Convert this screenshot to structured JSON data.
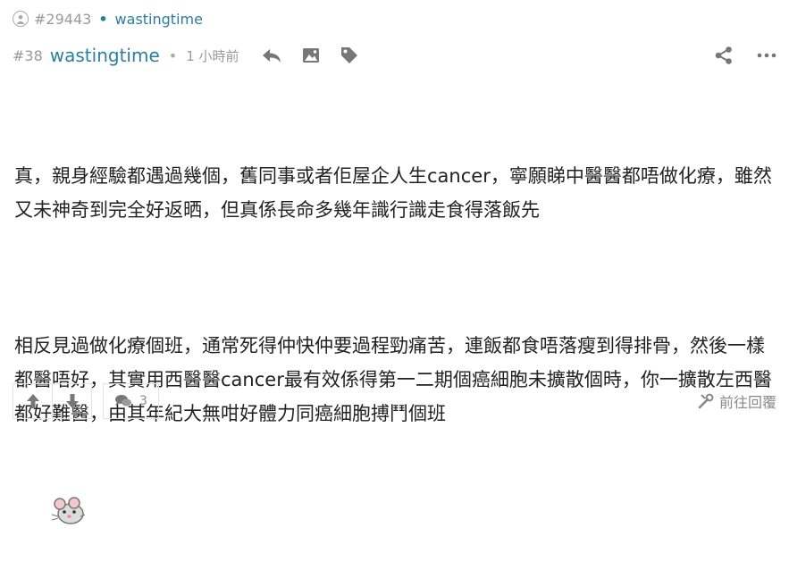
{
  "quote": {
    "number": "#29443",
    "dot": "•",
    "user": "wastingtime"
  },
  "post": {
    "number": "#38",
    "user": "wastingtime",
    "separator": "•",
    "time": "1 小時前",
    "paragraph1": "真，親身經驗都遇過幾個，舊同事或者佢屋企人生cancer，寧願睇中醫醫都唔做化療，雖然又未神奇到完全好返晒，但真係長命多幾年識行識走食得落飯先",
    "paragraph2": "相反見過做化療個班，通常死得仲快仲要過程勁痛苦，連飯都食唔落瘦到得排骨，然後一樣都醫唔好，其實用西醫醫cancer最有效係得第一二期個癌細胞未擴散個時，你一擴散左西醫都好難醫，由其年紀大無咁好體力同癌細胞搏鬥個班"
  },
  "footer": {
    "reply_count": "3",
    "goto_label": "前往回覆"
  },
  "colors": {
    "accent": "#2b7ea1",
    "muted": "#9a9a9a"
  }
}
